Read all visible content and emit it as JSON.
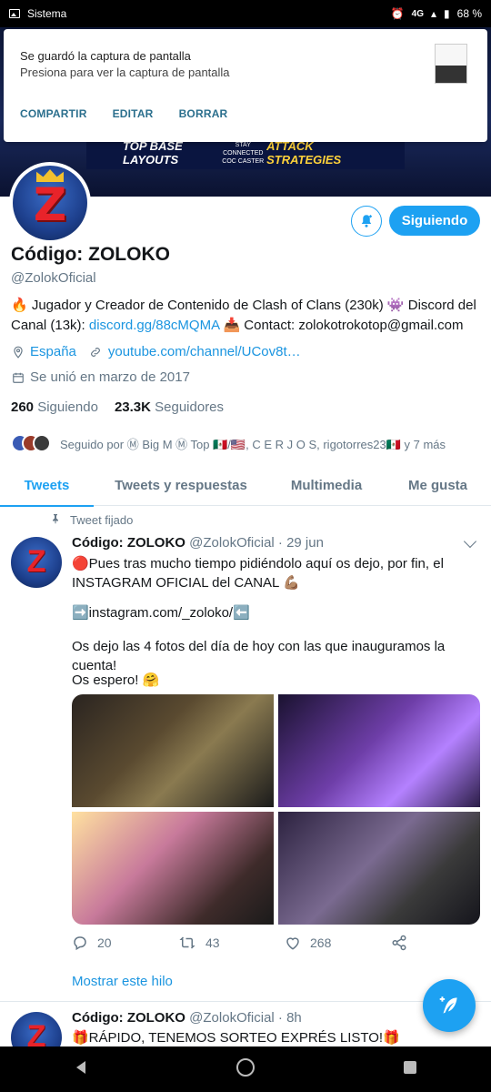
{
  "status_bar": {
    "app_name": "Sistema",
    "network": "4G",
    "battery": "68 %"
  },
  "notification": {
    "title": "Se guardó la captura de pantalla",
    "body": "Presiona para ver la captura de pantalla",
    "actions": [
      "COMPARTIR",
      "EDITAR",
      "BORRAR"
    ]
  },
  "banner": {
    "left_text": "TOP BASE LAYOUTS",
    "mid_text": "STAY CONNECTED",
    "mid_sub": "COC CASTER",
    "right_text": "ATTACK STRATEGIES"
  },
  "profile": {
    "name": "Código: ZOLOKO",
    "handle": "@ZolokOficial",
    "follow_label": "Siguiendo",
    "bio_part1": "🔥 Jugador y Creador de Contenido de Clash of Clans (230k) 👾 Discord del Canal (13k): ",
    "bio_link": "discord.gg/88cMQMA",
    "bio_part2": " 📥 Contact: zolokotrokotop@gmail.com",
    "location": "España",
    "website": "youtube.com/channel/UCov8t…",
    "joined": "Se unió en marzo de 2017",
    "following_count": "260",
    "following_label": "Siguiendo",
    "followers_count": "23.3K",
    "followers_label": "Seguidores",
    "followed_by": "Seguido por Ⓜ Big M Ⓜ Top 🇲🇽/🇺🇸, C E R J O S, rigotorres23🇲🇽 y 7 más"
  },
  "tabs": [
    "Tweets",
    "Tweets y respuestas",
    "Multimedia",
    "Me gusta"
  ],
  "tweet1": {
    "pinned_label": "Tweet fijado",
    "name": "Código: ZOLOKO",
    "meta": "@ZolokOficial · 29 jun",
    "line1": "🔴Pues tras mucho tiempo pidiéndolo aquí os dejo, por fin, el INSTAGRAM OFICIAL del CANAL 💪🏽",
    "line2": "➡️instagram.com/_zoloko/⬅️",
    "line3": "Os dejo las 4 fotos del día de hoy con las que inauguramos la cuenta!",
    "line4": "Os espero! 🤗",
    "replies": "20",
    "retweets": "43",
    "likes": "268",
    "show_thread": "Mostrar este hilo"
  },
  "tweet2": {
    "name": "Código: ZOLOKO",
    "meta": "@ZolokOficial · 8h",
    "text": "🎁RÁPIDO, TENEMOS SORTEO EXPRÉS LISTO!🎁"
  },
  "colors": {
    "accent": "#1da1f2",
    "text": "#14171a",
    "muted": "#657786"
  }
}
